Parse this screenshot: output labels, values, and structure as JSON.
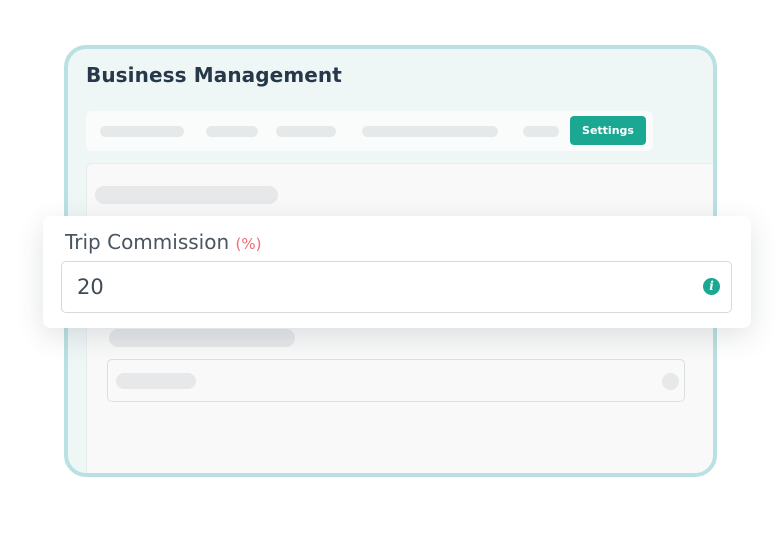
{
  "app": {
    "title": "Business Management"
  },
  "tabs": {
    "active_label": "Settings"
  },
  "field": {
    "label": "Trip Commission",
    "unit": "(%)",
    "value": "20",
    "info_icon": "info-icon",
    "info_glyph": "i"
  },
  "colors": {
    "accent": "#1aa893",
    "border": "#b9e1e1",
    "unit_text": "#ee6e73",
    "title_text": "#26384a"
  }
}
